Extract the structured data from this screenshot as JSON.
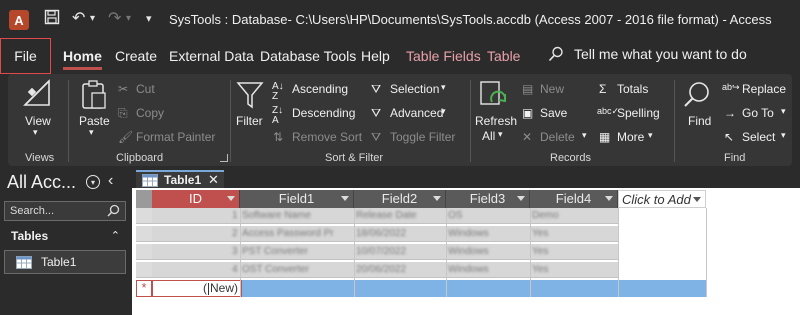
{
  "window": {
    "title": "SysTools : Database- C:\\Users\\HP\\Documents\\SysTools.accdb (Access 2007 - 2016 file format)  -  Access",
    "app_icon_letter": "A"
  },
  "menu_tabs": {
    "file": "File",
    "home": "Home",
    "create": "Create",
    "external_data": "External Data",
    "database_tools": "Database Tools",
    "help": "Help",
    "table_fields": "Table Fields",
    "table": "Table",
    "tell_me": "Tell me what you want to do"
  },
  "ribbon": {
    "views": {
      "view": "View",
      "group": "Views"
    },
    "clipboard": {
      "paste": "Paste",
      "cut": "Cut",
      "copy": "Copy",
      "format_painter": "Format Painter",
      "group": "Clipboard"
    },
    "sort_filter": {
      "filter": "Filter",
      "ascending": "Ascending",
      "descending": "Descending",
      "remove_sort": "Remove Sort",
      "selection": "Selection",
      "advanced": "Advanced",
      "toggle_filter": "Toggle Filter",
      "group": "Sort & Filter"
    },
    "records": {
      "refresh": "Refresh",
      "refresh_all": "All",
      "new": "New",
      "save": "Save",
      "delete": "Delete",
      "totals": "Totals",
      "spelling": "Spelling",
      "more": "More",
      "group": "Records"
    },
    "find": {
      "find": "Find",
      "replace": "Replace",
      "goto": "Go To",
      "select": "Select",
      "group": "Find"
    }
  },
  "nav_pane": {
    "title": "All Acc...",
    "search_placeholder": "Search...",
    "section": "Tables",
    "items": [
      {
        "label": "Table1"
      }
    ]
  },
  "document": {
    "tab_label": "Table1",
    "columns": [
      "ID",
      "Field1",
      "Field2",
      "Field3",
      "Field4",
      "Click to Add"
    ],
    "rows": [
      [
        "1",
        "Software Name",
        "Release Date",
        "OS",
        "Demo"
      ],
      [
        "2",
        "Access Password Pr",
        "18/06/2022",
        "Windows",
        "Yes"
      ],
      [
        "3",
        "PST Converter",
        "10/07/2022",
        "Windows",
        "Yes"
      ],
      [
        "4",
        "OST Converter",
        "20/06/2022",
        "Windows",
        "Yes"
      ]
    ],
    "new_row_label": "(New)",
    "new_record_marker": "*"
  },
  "colors": {
    "accent": "#c0504d",
    "selection_blue": "#7fb3e6",
    "chrome_dark": "#2b2b2b",
    "ribbon_bg": "#363636"
  }
}
